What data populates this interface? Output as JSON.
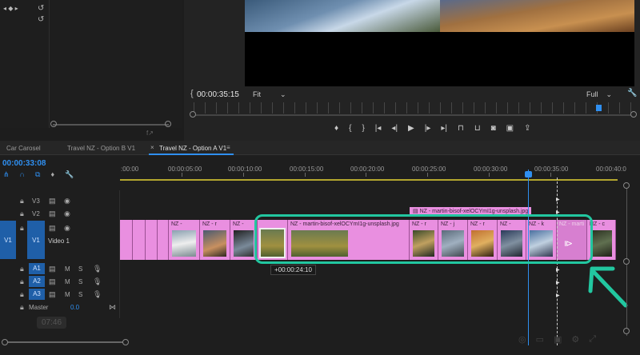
{
  "source_monitor": {
    "timecode": "",
    "fx_label": "f↗"
  },
  "program_monitor": {
    "timecode": "00:00:35:15",
    "fit_label": "Fit",
    "quality_label": "Full"
  },
  "tabs": [
    {
      "label": "Car Carosel"
    },
    {
      "label": "Travel NZ - Option B V1"
    },
    {
      "label": "Travel NZ - Option A V1"
    }
  ],
  "timeline": {
    "timecode": "00:00:33:08",
    "ruler_labels": [
      ":00:00",
      "00:00:05:00",
      "00:00:10:00",
      "00:00:15:00",
      "00:00:20:00",
      "00:00:25:00",
      "00:00:30:00",
      "00:00:35:00",
      "00:00:40:0"
    ],
    "tracks": {
      "v3": "V3",
      "v2": "V2",
      "v1": "V1",
      "v1_src": "V1",
      "video1": "Video 1",
      "a1": "A1",
      "a2": "A2",
      "a3": "A3",
      "master": "Master",
      "master_val": "0.0",
      "m": "M",
      "s": "S"
    },
    "clip_labels": {
      "nz1": "NZ -",
      "nz2": "NZ - r",
      "nz3": "NZ -",
      "main": "NZ - martin-bisof-xelOCYmI1g-unsplash.jpg",
      "upper": "NZ - martin-bisof-xelOCYmI1g-unsplash.jpg",
      "nz5": "NZ - r",
      "nz6": "NZ - j",
      "nz7": "NZ - r",
      "nz8": "NZ -",
      "nz9": "NZ - k",
      "nz10": "NZ - marti",
      "nz11": "NZ - c"
    },
    "offset_tooltip": "+00:00:24:10",
    "dim_label": "07:46"
  },
  "colors": {
    "accent": "#2f8ff0",
    "clip": "#e98fe0",
    "annotation": "#22c7a0",
    "track_target": "#1f5fa8"
  }
}
